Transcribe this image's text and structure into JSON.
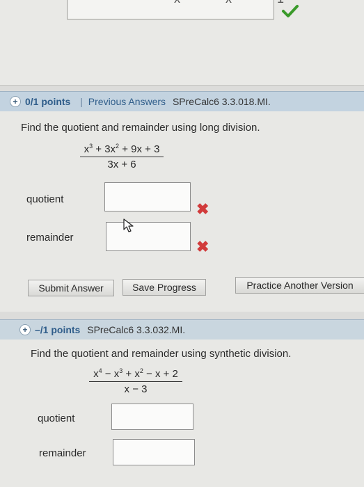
{
  "previous": {
    "answer_partial": "x  x  1"
  },
  "q1": {
    "points": "0/1 points",
    "separator": "|",
    "previous_answers": "Previous Answers",
    "code": "SPreCalc6 3.3.018.MI.",
    "prompt": "Find the quotient and remainder using long division.",
    "numerator": [
      "x",
      "3",
      " + 3x",
      "2",
      " + 9x + 3"
    ],
    "denominator": "3x + 6",
    "quotient_label": "quotient",
    "remainder_label": "remainder",
    "submit": "Submit Answer",
    "save": "Save Progress",
    "practice": "Practice Another Version"
  },
  "q2": {
    "points": "–/1 points",
    "code": "SPreCalc6 3.3.032.MI.",
    "prompt": "Find the quotient and remainder using synthetic division.",
    "numerator": [
      "x",
      "4",
      " − x",
      "3",
      " + x",
      "2",
      " − x + 2"
    ],
    "denominator": "x − 3",
    "quotient_label": "quotient",
    "remainder_label": "remainder"
  },
  "icons": {
    "check": "check-icon",
    "wrong": "x-mark-icon",
    "expand": "plus-icon",
    "cursor": "cursor-icon"
  },
  "colors": {
    "header_bg": "#c3d3e0",
    "link": "#2f5d8a",
    "wrong": "#d13b3b",
    "correct": "#3a9a2a"
  }
}
